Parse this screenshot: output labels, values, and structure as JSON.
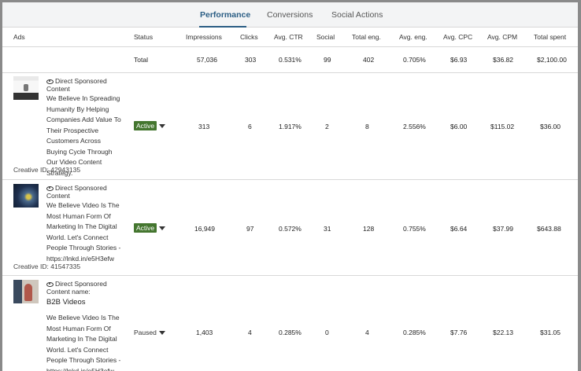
{
  "tabs": [
    {
      "label": "Performance",
      "active": true
    },
    {
      "label": "Conversions",
      "active": false
    },
    {
      "label": "Social Actions",
      "active": false
    }
  ],
  "headers": {
    "ads": "Ads",
    "status": "Status",
    "impressions": "Impressions",
    "clicks": "Clicks",
    "avg_ctr": "Avg. CTR",
    "social": "Social",
    "total_eng": "Total eng.",
    "avg_eng": "Avg. eng.",
    "avg_cpc": "Avg. CPC",
    "avg_cpm": "Avg. CPM",
    "total_spent": "Total spent"
  },
  "total": {
    "label": "Total",
    "impressions": "57,036",
    "clicks": "303",
    "avg_ctr": "0.531%",
    "social": "99",
    "total_eng": "402",
    "avg_eng": "0.705%",
    "avg_cpc": "$6.93",
    "avg_cpm": "$36.82",
    "total_spent": "$2,100.00"
  },
  "rows": [
    {
      "type": "Direct Sponsored Content",
      "name": "",
      "description": "We Believe In Spreading Humanity By Helping Companies Add Value To Their Prospective Customers Across Buying Cycle Through Our Video Content Strategy.",
      "creative_id": "Creative ID: 42943135",
      "status": "Active",
      "impressions": "313",
      "clicks": "6",
      "avg_ctr": "1.917%",
      "social": "2",
      "total_eng": "8",
      "avg_eng": "2.556%",
      "avg_cpc": "$6.00",
      "avg_cpm": "$115.02",
      "total_spent": "$36.00"
    },
    {
      "type": "Direct Sponsored Content",
      "name": "",
      "description": "We Believe Video Is The Most Human Form Of Marketing In The Digital World. Let's Connect People Through Stories - https://lnkd.in/e5H3efw",
      "creative_id": "Creative ID: 41547335",
      "status": "Active",
      "impressions": "16,949",
      "clicks": "97",
      "avg_ctr": "0.572%",
      "social": "31",
      "total_eng": "128",
      "avg_eng": "0.755%",
      "avg_cpc": "$6.64",
      "avg_cpm": "$37.99",
      "total_spent": "$643.88"
    },
    {
      "type": "Direct Sponsored Content name:",
      "name": "B2B Videos",
      "description": "We Believe Video Is The Most Human Form Of Marketing In The Digital World. Let's Connect People Through Stories - https://lnkd.in/e5H3efw",
      "creative_id": "",
      "status": "Paused",
      "impressions": "1,403",
      "clicks": "4",
      "avg_ctr": "0.285%",
      "social": "0",
      "total_eng": "4",
      "avg_eng": "0.285%",
      "avg_cpc": "$7.76",
      "avg_cpm": "$22.13",
      "total_spent": "$31.05"
    }
  ],
  "icons": {
    "content_type": "eye-icon",
    "status_dropdown": "caret-down-icon"
  },
  "colors": {
    "accent": "#2a5d84",
    "active_badge": "#44762f"
  }
}
